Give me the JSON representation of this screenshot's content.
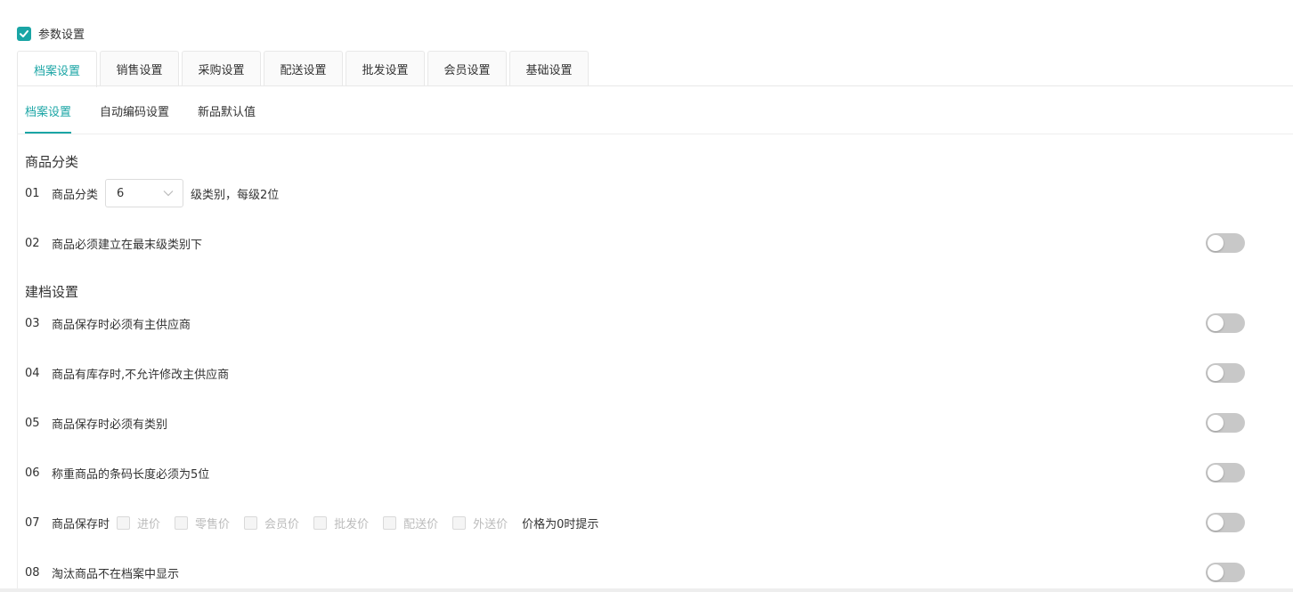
{
  "param_setting": {
    "label": "参数设置",
    "checked": true
  },
  "tabs": [
    {
      "label": "档案设置",
      "active": true
    },
    {
      "label": "销售设置"
    },
    {
      "label": "采购设置"
    },
    {
      "label": "配送设置"
    },
    {
      "label": "批发设置"
    },
    {
      "label": "会员设置"
    },
    {
      "label": "基础设置"
    }
  ],
  "subtabs": [
    {
      "label": "档案设置",
      "active": true
    },
    {
      "label": "自动编码设置"
    },
    {
      "label": "新品默认值"
    }
  ],
  "sections": {
    "category": "商品分类",
    "archive": "建档设置"
  },
  "rows": {
    "r01": {
      "num": "01",
      "label": "商品分类",
      "select_value": "6",
      "after": "级类别，每级2位"
    },
    "r02": {
      "num": "02",
      "label": "商品必须建立在最末级类别下",
      "enabled": false
    },
    "r03": {
      "num": "03",
      "label": "商品保存时必须有主供应商",
      "enabled": false
    },
    "r04": {
      "num": "04",
      "label": "商品有库存时,不允许修改主供应商",
      "enabled": false
    },
    "r05": {
      "num": "05",
      "label": "商品保存时必须有类别",
      "enabled": false
    },
    "r06": {
      "num": "06",
      "label": "称重商品的条码长度必须为5位",
      "enabled": false
    },
    "r07": {
      "num": "07",
      "label": "商品保存时",
      "options": [
        "进价",
        "零售价",
        "会员价",
        "批发价",
        "配送价",
        "外送价"
      ],
      "hint": "价格为0时提示",
      "enabled": false
    },
    "r08": {
      "num": "08",
      "label": "淘汰商品不在档案中显示",
      "enabled": false
    }
  },
  "colors": {
    "accent": "#1aa5a5",
    "toggle_off": "#c8c8c8"
  }
}
